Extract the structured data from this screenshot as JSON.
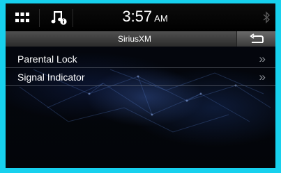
{
  "status_bar": {
    "time": "3:57",
    "ampm": "AM",
    "icons": [
      "grid-menu-icon",
      "music-info-icon",
      "bluetooth-icon"
    ]
  },
  "title_bar": {
    "title": "SiriusXM",
    "back_icon": "back-arrow-icon"
  },
  "menu": {
    "items": [
      {
        "label": "Parental Lock",
        "chevron": "»"
      },
      {
        "label": "Signal Indicator",
        "chevron": "»"
      }
    ]
  },
  "colors": {
    "frame": "#17d1ee",
    "background": "#04070f",
    "text": "#ffffff",
    "chevron": "#8c8f95"
  }
}
